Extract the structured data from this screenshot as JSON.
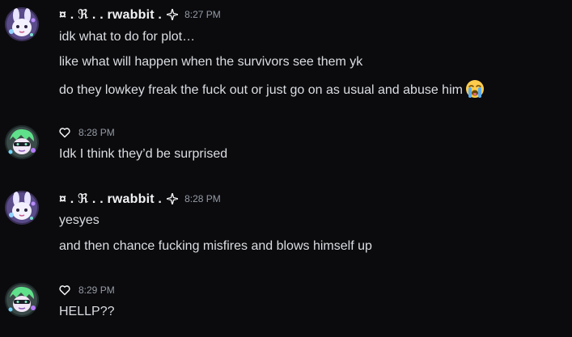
{
  "messages": [
    {
      "user": {
        "name_prefix": "¤ . ℜ .  . ",
        "name": "rwabbit",
        "name_suffix": " . ",
        "avatar": "bunny-avatar"
      },
      "timestamp": "8:27 PM",
      "lines": [
        "idk what to do for plot…",
        "like what will happen when the survivors see them yk",
        "do they lowkey freak the fuck out or just go on as usual and abuse him"
      ],
      "emoji": "loudly-crying-face"
    },
    {
      "user": {
        "name": "♡",
        "avatar": "green-hair-avatar"
      },
      "timestamp": "8:28 PM",
      "lines": [
        "Idk I think they’d be surprised"
      ]
    },
    {
      "user": {
        "name_prefix": "¤ . ℜ .  . ",
        "name": "rwabbit",
        "name_suffix": " . ",
        "avatar": "bunny-avatar"
      },
      "timestamp": "8:28 PM",
      "lines": [
        "yesyes",
        "and then chance fucking misfires and blows himself up"
      ]
    },
    {
      "user": {
        "name": "♡",
        "avatar": "green-hair-avatar"
      },
      "timestamp": "8:29 PM",
      "lines": [
        "HELLP??"
      ]
    }
  ],
  "colors": {
    "background": "#0b0b0e",
    "text": "#dbdee1",
    "username": "#f2f3f5",
    "timestamp": "#949ba4"
  }
}
